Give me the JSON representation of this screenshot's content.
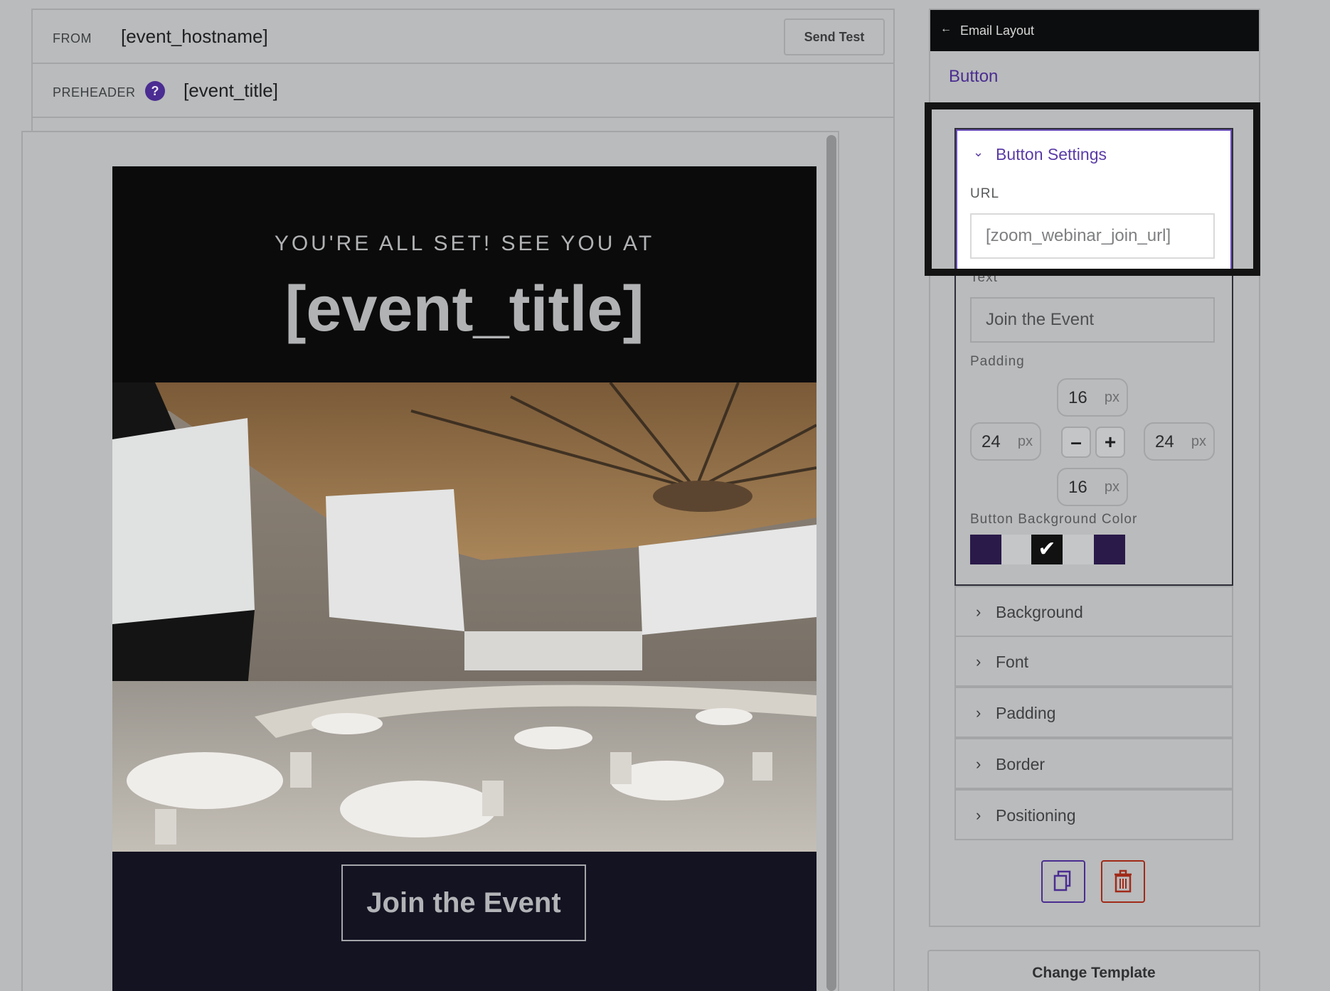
{
  "editor": {
    "from_label": "FROM",
    "from_value": "[event_hostname]",
    "send_test": "Send Test",
    "preheader_label": "PREHEADER",
    "help_icon": "?",
    "preheader_value": "[event_title]"
  },
  "email": {
    "kicker": "YOU'RE ALL SET! SEE YOU AT",
    "title": "[event_title]",
    "photo_icon": "auditorium-photo",
    "cta": "Join the Event"
  },
  "panel": {
    "back_icon": "arrow-left-icon",
    "back_label": "Email Layout",
    "title": "Button",
    "settings": {
      "header": "Button Settings",
      "url_label": "URL",
      "url_value": "[zoom_webinar_join_url]",
      "text_label": "Text",
      "text_value": "Join the Event",
      "padding_label": "Padding",
      "padding": {
        "top": "16",
        "left": "24",
        "right": "24",
        "bottom": "16",
        "unit": "px"
      },
      "minus": "–",
      "plus": "+",
      "bg_color_label": "Button Background Color",
      "swatches": [
        {
          "color": "#2a1a4a",
          "selected": false
        },
        {
          "color": "#b9bbbc",
          "selected": false
        },
        {
          "color": "#111111",
          "selected": true
        },
        {
          "color": "#b9bbbc",
          "selected": false
        },
        {
          "color": "#2a1a4a",
          "selected": false
        }
      ],
      "check": "✔"
    },
    "accordions": [
      "Background",
      "Font",
      "Padding",
      "Border",
      "Positioning"
    ],
    "chevron": "›",
    "chevron_down": "⌄",
    "copy_icon": "copy-icon",
    "delete_icon": "trash-icon",
    "change_template": "Change Template"
  },
  "colors": {
    "accent": "#5a3ba6",
    "danger": "#a12a18",
    "header_bg": "#0c0d0e",
    "cta_band": "#131322"
  }
}
